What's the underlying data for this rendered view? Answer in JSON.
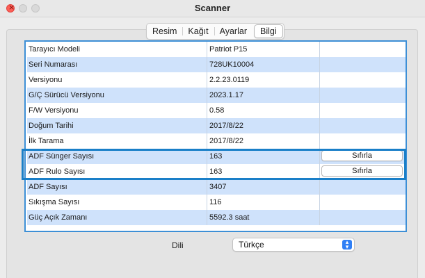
{
  "window": {
    "title": "Scanner"
  },
  "tabs": [
    {
      "label": "Resim",
      "active": false
    },
    {
      "label": "Kağıt",
      "active": false
    },
    {
      "label": "Ayarlar",
      "active": false
    },
    {
      "label": "Bilgi",
      "active": true
    }
  ],
  "info_rows": [
    {
      "label": "Tarayıcı Modeli",
      "value": "Patriot P15"
    },
    {
      "label": "Seri Numarası",
      "value": "728UK10004"
    },
    {
      "label": "Versiyonu",
      "value": "2.2.23.0119"
    },
    {
      "label": "G/Ç Sürücü Versiyonu",
      "value": "2023.1.17"
    },
    {
      "label": "F/W Versiyonu",
      "value": "0.58"
    },
    {
      "label": "Doğum Tarihi",
      "value": "2017/8/22"
    },
    {
      "label": "İlk Tarama",
      "value": "2017/8/22"
    },
    {
      "label": "ADF Sünger Sayısı",
      "value": "163",
      "button": "Sıfırla"
    },
    {
      "label": "ADF Rulo Sayısı",
      "value": "163",
      "button": "Sıfırla"
    },
    {
      "label": "ADF Sayısı",
      "value": "3407"
    },
    {
      "label": "Sıkışma Sayısı",
      "value": "116"
    },
    {
      "label": "Güç Açık Zamanı",
      "value": "5592.3 saat"
    }
  ],
  "language": {
    "label": "Dili",
    "value": "Türkçe"
  },
  "colors": {
    "highlight": "#1a7fc8",
    "table_border": "#3d8fd6",
    "row_alt": "#cfe2fb",
    "select_accent": "#2f7ff5"
  }
}
